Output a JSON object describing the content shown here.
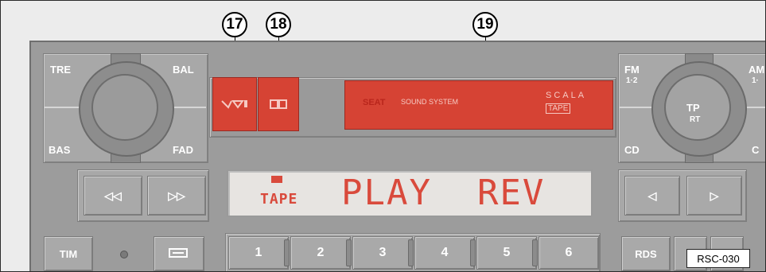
{
  "callouts": [
    {
      "number": "17"
    },
    {
      "number": "18"
    },
    {
      "number": "19"
    }
  ],
  "left_knob": {
    "labels": {
      "top_left": "TRE",
      "top_right": "BAL",
      "bottom_left": "BAS",
      "bottom_right": "FAD"
    }
  },
  "right_knob": {
    "labels": {
      "fm": "FM",
      "fm_sub": "1·2",
      "am": "AM",
      "am_sub": "1·",
      "cd": "CD",
      "c": "C"
    },
    "center": {
      "line1": "TP",
      "line2": "RT"
    }
  },
  "tape_brand": {
    "brand": "SEAT",
    "subtitle": "SOUND SYSTEM",
    "model_line1": "SCALA",
    "model_line2": "TAPE"
  },
  "display": {
    "small": "TAPE",
    "main": "PLAY  REV"
  },
  "seek_left": {
    "left": "◁◁",
    "right": "▷▷"
  },
  "seek_right": {
    "left": "◁",
    "right": "▷"
  },
  "buttons": {
    "tim": "TIM",
    "rds": "RDS"
  },
  "presets": [
    "1",
    "2",
    "3",
    "4",
    "5",
    "6"
  ],
  "badge": "RSC-030",
  "colors": {
    "accent_red": "#d64334",
    "display_text": "#d94a3c",
    "body_gray": "#9c9c9c"
  }
}
